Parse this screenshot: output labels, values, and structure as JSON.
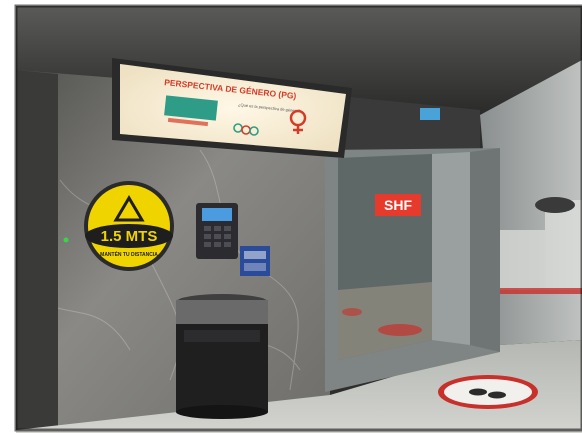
{
  "screen": {
    "title": "PERSPECTIVA DE GÉNERO (PG)",
    "panel_heading": "¿Qué es la perspectiva de género?"
  },
  "distance_sign": {
    "text": "1.5 MTS",
    "subtext": "MANTÉN TU DISTANCIA",
    "icon": "warning-triangle-icon"
  },
  "elevator_logo": {
    "text": "SHF"
  },
  "floor_decal": {
    "icon": "footprints-icon"
  },
  "colors": {
    "sign_yellow": "#f0d400",
    "logo_red": "#e53a2c",
    "screen_bg": "#fbf2df",
    "screen_title": "#d43c2a",
    "screen_panel": "#2e9c86",
    "decal_red": "#c8302c"
  }
}
